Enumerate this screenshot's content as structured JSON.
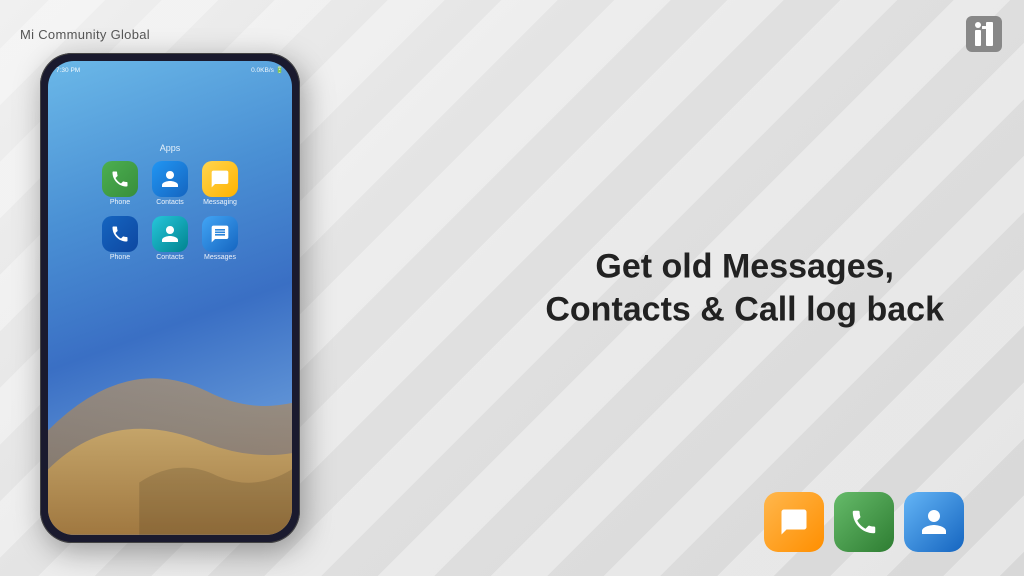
{
  "header": {
    "brand": "Mi Community Global",
    "logo_alt": "MIUI Logo"
  },
  "phone": {
    "status_bar": {
      "time": "7:30 PM",
      "network": "0.0KB/s",
      "battery": "■■■"
    },
    "apps_section_label": "Apps",
    "app_rows": [
      [
        {
          "label": "Phone",
          "icon_class": "icon-phone-green",
          "icon_char": "📞"
        },
        {
          "label": "Contacts",
          "icon_class": "icon-contacts-blue",
          "icon_char": "👤"
        },
        {
          "label": "Messaging",
          "icon_class": "icon-messaging-yellow",
          "icon_char": "✉"
        }
      ],
      [
        {
          "label": "Phone",
          "icon_class": "icon-phone-blue",
          "icon_char": "📞"
        },
        {
          "label": "Contacts",
          "icon_class": "icon-contacts-teal",
          "icon_char": "👤"
        },
        {
          "label": "Messages",
          "icon_class": "icon-messages-blue",
          "icon_char": "💬"
        }
      ]
    ]
  },
  "main_heading_line1": "Get old Messages,",
  "main_heading_line2": "Contacts & Call log back",
  "bottom_icons": [
    {
      "label": "Messaging icon",
      "icon_char": "✉",
      "style_class": "btn-orange"
    },
    {
      "label": "Phone icon",
      "icon_char": "📞",
      "style_class": "btn-green"
    },
    {
      "label": "Contacts icon",
      "icon_char": "👤",
      "style_class": "btn-blue"
    }
  ]
}
